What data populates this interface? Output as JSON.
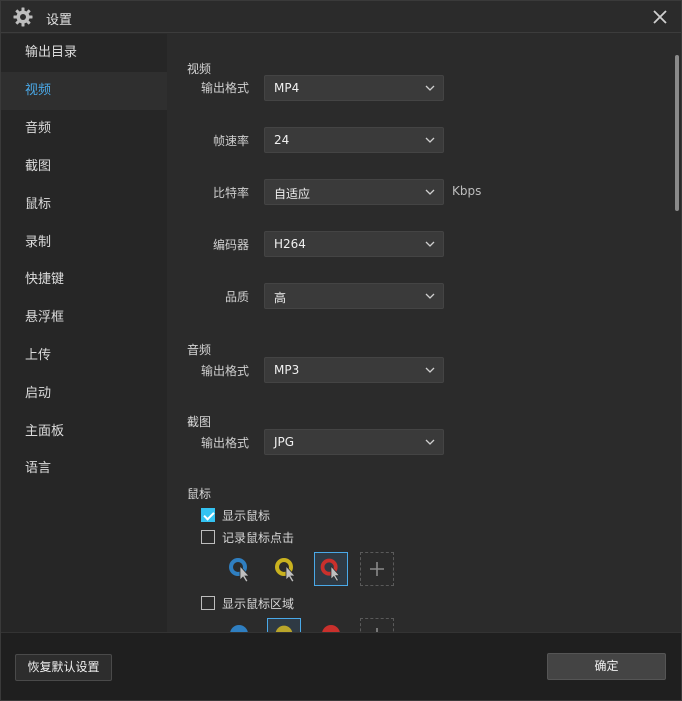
{
  "window": {
    "title": "设置",
    "icon": "gear-icon",
    "close_icon": "close-icon"
  },
  "sidebar": {
    "items": [
      {
        "label": "输出目录",
        "active": false
      },
      {
        "label": "视频",
        "active": true
      },
      {
        "label": "音频",
        "active": false
      },
      {
        "label": "截图",
        "active": false
      },
      {
        "label": "鼠标",
        "active": false
      },
      {
        "label": "录制",
        "active": false
      },
      {
        "label": "快捷键",
        "active": false
      },
      {
        "label": "悬浮框",
        "active": false
      },
      {
        "label": "上传",
        "active": false
      },
      {
        "label": "启动",
        "active": false
      },
      {
        "label": "主面板",
        "active": false
      },
      {
        "label": "语言",
        "active": false
      }
    ]
  },
  "video": {
    "title": "视频",
    "format_label": "输出格式",
    "format_value": "MP4",
    "fps_label": "帧速率",
    "fps_value": "24",
    "bitrate_label": "比特率",
    "bitrate_value": "自适应",
    "bitrate_unit": "Kbps",
    "encoder_label": "编码器",
    "encoder_value": "H264",
    "quality_label": "品质",
    "quality_value": "高"
  },
  "audio": {
    "title": "音频",
    "format_label": "输出格式",
    "format_value": "MP3"
  },
  "screenshot": {
    "title": "截图",
    "format_label": "输出格式",
    "format_value": "JPG"
  },
  "mouse": {
    "title": "鼠标",
    "show_cursor": {
      "label": "显示鼠标",
      "checked": true
    },
    "record_clicks": {
      "label": "记录鼠标点击",
      "checked": false
    },
    "show_area": {
      "label": "显示鼠标区域",
      "checked": false
    },
    "click_styles": [
      {
        "icon": "cursor-blue-ring-icon",
        "color": "#2f7fc1",
        "selected": false
      },
      {
        "icon": "cursor-yellow-ring-icon",
        "color": "#c9b21f",
        "selected": false
      },
      {
        "icon": "cursor-red-ring-icon",
        "color": "#c9302c",
        "selected": true
      },
      {
        "icon": "add-icon",
        "selected": false
      }
    ],
    "area_styles": [
      {
        "icon": "area-blue-icon",
        "color": "#2f7fc1",
        "selected": false
      },
      {
        "icon": "area-yellow-icon",
        "color": "#c9b21f",
        "selected": true
      },
      {
        "icon": "area-red-icon",
        "color": "#c9302c",
        "selected": false
      },
      {
        "icon": "add-icon",
        "selected": false
      }
    ]
  },
  "footer": {
    "reset_label": "恢复默认设置",
    "ok_label": "确定"
  },
  "colors": {
    "accent": "#4aa9e8",
    "checkbox": "#34c3f2"
  }
}
